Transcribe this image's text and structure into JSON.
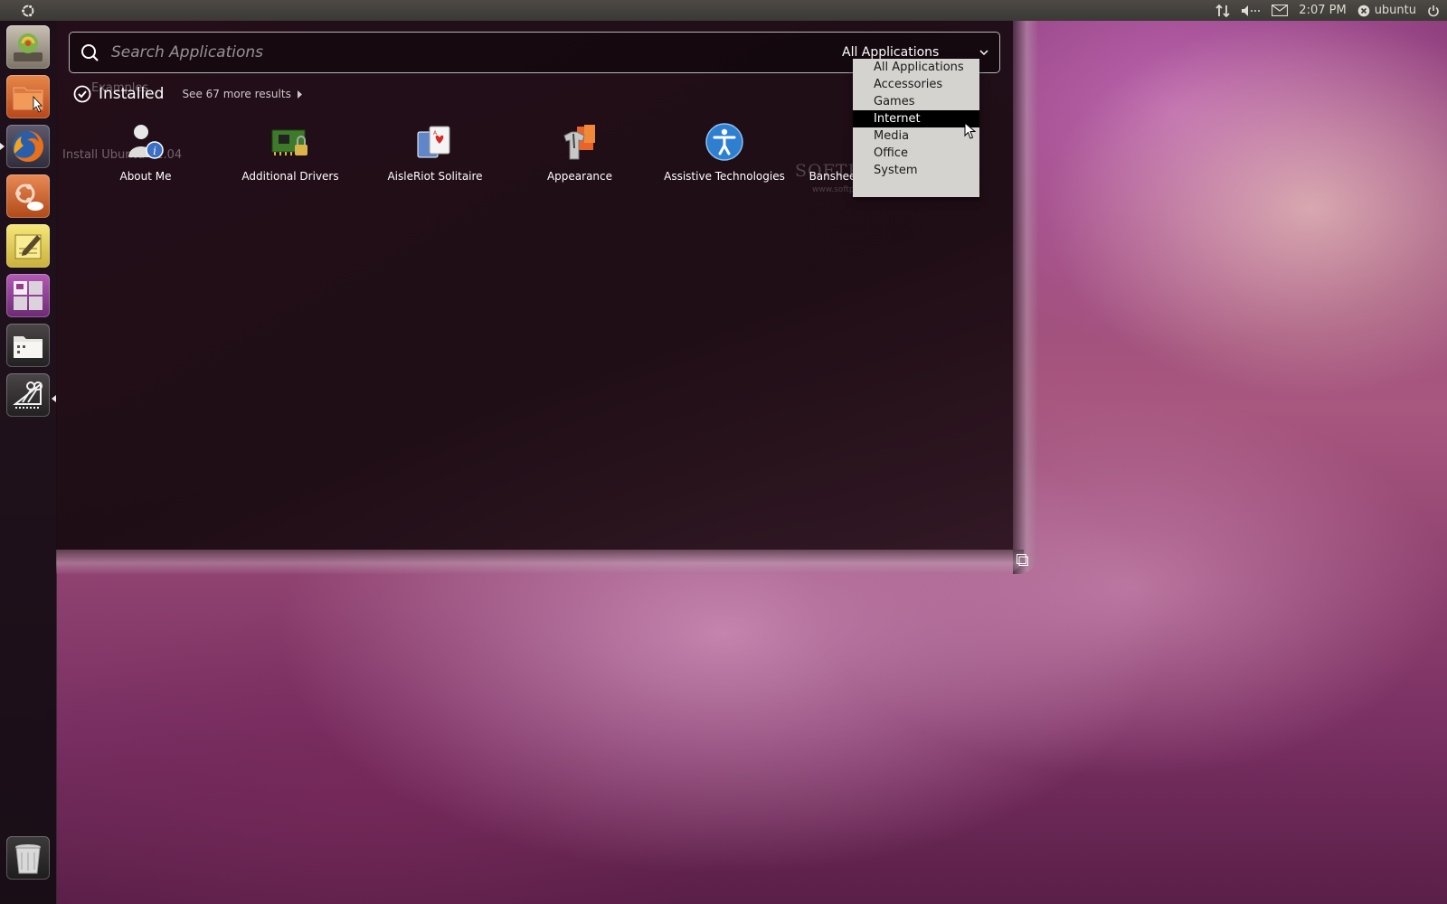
{
  "panel": {
    "time": "2:07 PM",
    "user": "ubuntu"
  },
  "launcher": {
    "items": [
      {
        "name": "installer",
        "icon": "installer-icon"
      },
      {
        "name": "home-folder",
        "icon": "folder-icon"
      },
      {
        "name": "firefox",
        "icon": "firefox-icon"
      },
      {
        "name": "ubuntu-one",
        "icon": "ubuntu-one-icon"
      },
      {
        "name": "text-editor",
        "icon": "notepad-icon"
      },
      {
        "name": "workspaces",
        "icon": "workspace-switcher-icon"
      },
      {
        "name": "files-and-folders",
        "icon": "files-icon"
      },
      {
        "name": "applications",
        "icon": "applications-icon"
      },
      {
        "name": "trash",
        "icon": "trash-icon"
      }
    ]
  },
  "dash": {
    "search": {
      "placeholder": "Search Applications"
    },
    "filter": {
      "selected": "All Applications",
      "options": [
        "All Applications",
        "Accessories",
        "Games",
        "Internet",
        "Media",
        "Office",
        "System"
      ],
      "highlighted": "Internet"
    },
    "section": {
      "title": "Installed",
      "more_results": "See 67 more results"
    },
    "background_items": {
      "examples": "Examples",
      "install": "Install Ubuntu 11.04"
    },
    "apps": [
      {
        "label": "About Me",
        "icon": "about-me-icon"
      },
      {
        "label": "Additional Drivers",
        "icon": "additional-drivers-icon"
      },
      {
        "label": "AisleRiot Solitaire",
        "icon": "solitaire-icon"
      },
      {
        "label": "Appearance",
        "icon": "appearance-icon"
      },
      {
        "label": "Assistive Technologies",
        "icon": "accessibility-icon"
      },
      {
        "label": "Banshee Media Player",
        "icon": "banshee-icon"
      }
    ],
    "watermark": {
      "text": "SOFTPEDIA",
      "url": "www.softpedia.com"
    }
  },
  "colors": {
    "accent": "#dd4814",
    "panel": "#3c3b37",
    "highlight": "#000000"
  }
}
